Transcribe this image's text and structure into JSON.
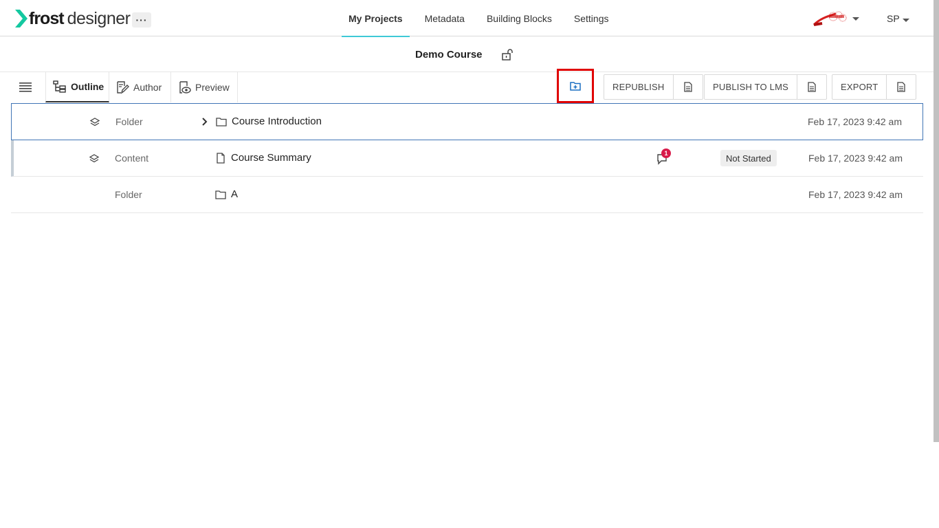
{
  "brand": {
    "name_bold": "frost",
    "name_light": "designer",
    "accent": "#14c8a0"
  },
  "header": {
    "more_label": "···",
    "nav": [
      {
        "label": "My Projects",
        "active": true
      },
      {
        "label": "Metadata",
        "active": false
      },
      {
        "label": "Building Blocks",
        "active": false
      },
      {
        "label": "Settings",
        "active": false
      }
    ],
    "user_initials": "SP"
  },
  "project": {
    "title": "Demo Course"
  },
  "toolbar": {
    "tabs": [
      {
        "label": "Outline",
        "active": true
      },
      {
        "label": "Author",
        "active": false
      },
      {
        "label": "Preview",
        "active": false
      }
    ],
    "republish_label": "REPUBLISH",
    "publish_label": "PUBLISH TO LMS",
    "export_label": "EXPORT"
  },
  "rows": [
    {
      "type": "Folder",
      "name": "Course Introduction",
      "date": "Feb 17, 2023 9:42 am"
    },
    {
      "type": "Content",
      "name": "Course Summary",
      "date": "Feb 17, 2023 9:42 am",
      "comment_count": "1",
      "status": "Not Started"
    },
    {
      "type": "Folder",
      "name": "A",
      "date": "Feb 17, 2023 9:42 am"
    }
  ],
  "colors": {
    "nav_active": "#3ec9d6",
    "selected_border": "#3f74b5",
    "highlight": "#e00000",
    "badge": "#d81b4a"
  }
}
